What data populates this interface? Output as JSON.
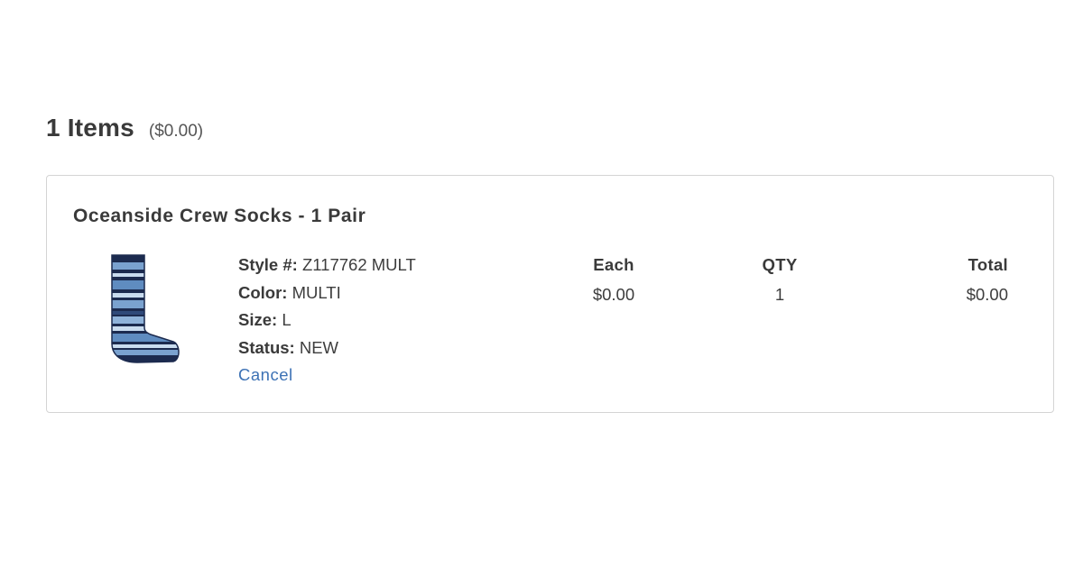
{
  "summary": {
    "items_label": "1 Items",
    "total_label": "($0.00)"
  },
  "product": {
    "name": "Oceanside Crew Socks - 1 Pair",
    "image_icon": "sock-product-image",
    "style_label": "Style #:",
    "style_value": "Z117762 MULT",
    "color_label": "Color:",
    "color_value": "MULTI",
    "size_label": "Size:",
    "size_value": "L",
    "status_label": "Status:",
    "status_value": "NEW",
    "cancel_label": "Cancel"
  },
  "pricing": {
    "each_header": "Each",
    "each_value": "$0.00",
    "qty_header": "QTY",
    "qty_value": "1",
    "total_header": "Total",
    "total_value": "$0.00"
  },
  "colors": {
    "link": "#3d72b5",
    "border": "#d4d4d4",
    "text": "#3d3d3d",
    "sock_navy": "#1c2b4f",
    "sock_blue": "#7aa2cf",
    "sock_light": "#c9dcef"
  }
}
